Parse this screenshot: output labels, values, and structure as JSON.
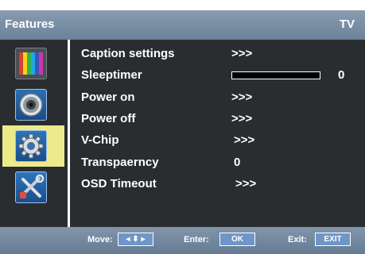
{
  "title": "Features",
  "source": "TV",
  "sidebar": {
    "items": [
      {
        "icon": "color-bars-icon"
      },
      {
        "icon": "speaker-icon"
      },
      {
        "icon": "gear-icon"
      },
      {
        "icon": "tools-icon"
      }
    ],
    "selected_index": 2
  },
  "menu": {
    "items": [
      {
        "label": "Caption settings",
        "value": ">>>"
      },
      {
        "label": "Sleeptimer",
        "value": "0",
        "level": 0
      },
      {
        "label": "Power on",
        "value": ">>>"
      },
      {
        "label": "Power off",
        "value": ">>>"
      },
      {
        "label": "V-Chip",
        "value": ">>>"
      },
      {
        "label": "Transpaerncy",
        "value": "0"
      },
      {
        "label": "OSD Timeout",
        "value": ">>>"
      }
    ]
  },
  "footer": {
    "move_label": "Move:",
    "move_key": "◂ ⬍ ▸",
    "enter_label": "Enter:",
    "enter_key": "OK",
    "exit_label": "Exit:",
    "exit_key": "EXIT"
  },
  "colors": {
    "panel_background": "#2a2d30",
    "title_bar": "#7a8ea4",
    "selected_item": "#ecea8a",
    "key_button": "#6f95c9"
  }
}
